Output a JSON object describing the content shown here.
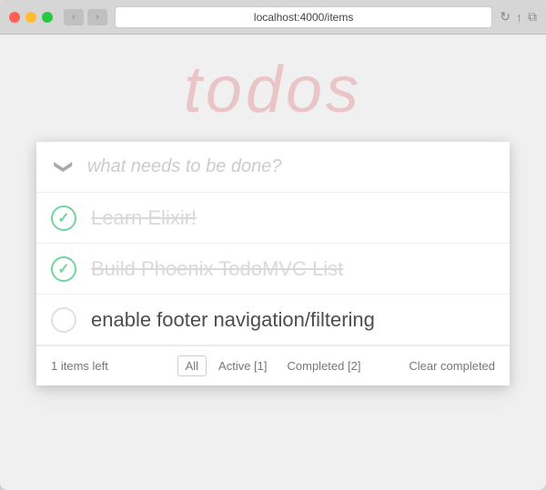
{
  "browser": {
    "url": "localhost:4000/items",
    "back_icon": "‹",
    "forward_icon": "›",
    "refresh_icon": "↻",
    "share_icon": "↑",
    "duplicate_icon": "⧉"
  },
  "app": {
    "title": "todos",
    "input_placeholder": "what needs to be done?"
  },
  "todos": [
    {
      "id": 1,
      "text": "Learn Elixir!",
      "completed": true
    },
    {
      "id": 2,
      "text": "Build Phoenix TodoMVC List",
      "completed": true
    },
    {
      "id": 3,
      "text": "enable footer navigation/filtering",
      "completed": false
    }
  ],
  "footer": {
    "items_left": "1 items left",
    "filter_all": "All",
    "filter_active": "Active [1]",
    "filter_completed": "Completed [2]",
    "clear_completed": "Clear completed",
    "active_filter": "all"
  },
  "toggle_all_icon": "❯"
}
